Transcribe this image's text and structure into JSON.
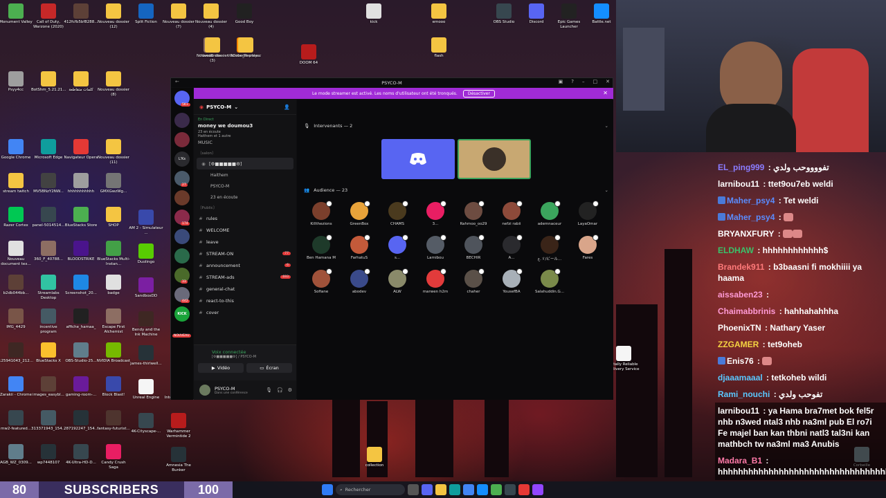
{
  "desktop_icons": [
    {
      "label": "Monument Valley",
      "color": "#4caf50"
    },
    {
      "label": "Call of Duty, Warzone (2020)",
      "color": "#c62828"
    },
    {
      "label": "412fcfb5bf8288...",
      "color": "#5d4037"
    },
    {
      "label": "Nouveau dossier (12)",
      "color": "#f4c542"
    },
    {
      "label": "Split Fiction",
      "color": "#1565c0"
    },
    {
      "label": "Nouveau dossier (7)",
      "color": "#f4c542"
    },
    {
      "label": "Nouveau dossier (4)",
      "color": "#f4c542"
    },
    {
      "label": "Good Boy",
      "color": "#212121"
    },
    {
      "label": "kick",
      "color": "#e0e0e0"
    },
    {
      "label": "emooo",
      "color": "#f4c542"
    },
    {
      "label": "OBS Studio",
      "color": "#37474f"
    },
    {
      "label": "Discord",
      "color": "#5865f2"
    },
    {
      "label": "Epic Games Launcher",
      "color": "#222"
    },
    {
      "label": "Battle.net",
      "color": "#148eff"
    },
    {
      "label": "HandBrake",
      "color": "#8d6e63"
    },
    {
      "label": "VLC media player",
      "color": "#ff8800"
    },
    {
      "label": "Psyy4cc",
      "color": "#9e9e9e"
    },
    {
      "label": "BotShm_5.21.21...",
      "color": "#f4c542"
    },
    {
      "label": "كلمات متقاطعة",
      "color": "#f4c542"
    },
    {
      "label": "Nouveau dossier (8)",
      "color": "#f4c542"
    },
    {
      "label": "Nouveau dossier (3)",
      "color": "#f4c542"
    },
    {
      "label": "Adobe_Premie...",
      "color": "#f4c542"
    },
    {
      "label": "DOOM 64",
      "color": "#b71c1c"
    },
    {
      "label": "flash",
      "color": "#f4c542"
    },
    {
      "label": "Google Chrome",
      "color": "#4285f4"
    },
    {
      "label": "Microsoft Edge",
      "color": "#0f9d9d"
    },
    {
      "label": "Navigateur Opera",
      "color": "#e53935"
    },
    {
      "label": "Nouveau dossier (11)",
      "color": "#f4c542"
    },
    {
      "label": "stream twitch",
      "color": "#f4c542"
    },
    {
      "label": "MV5BNzY2NW...",
      "color": "#424242"
    },
    {
      "label": "hhhhhhhhhhh",
      "color": "#9e9e9e"
    },
    {
      "label": "GMXGwzWg...",
      "color": "#757575"
    },
    {
      "label": "Razer Cortex",
      "color": "#00c853"
    },
    {
      "label": "panel-5014514...",
      "color": "#37474f"
    },
    {
      "label": "BlueStacks Store",
      "color": "#4caf50"
    },
    {
      "label": "SHOP",
      "color": "#f4c542"
    },
    {
      "label": "Nouveau document tex...",
      "color": "#e0e0e0"
    },
    {
      "label": "360_F_40788...",
      "color": "#8d6e63"
    },
    {
      "label": "BLOODSTRIKE",
      "color": "#4a148c"
    },
    {
      "label": "BlueStacks Multi-Instan...",
      "color": "#43a047"
    },
    {
      "label": "b2db044bb...",
      "color": "#5d4037"
    },
    {
      "label": "Streamlabs Desktop",
      "color": "#31c3a2"
    },
    {
      "label": "Screenshot_20...",
      "color": "#1e88e5"
    },
    {
      "label": "badge",
      "color": "#e0e0e0"
    },
    {
      "label": "IMG_4429",
      "color": "#795548"
    },
    {
      "label": "incentive program",
      "color": "#455a64"
    },
    {
      "label": "affiche_hamaa_",
      "color": "#212121"
    },
    {
      "label": "Escape First Alchemist",
      "color": "#8d6e63"
    },
    {
      "label": "125941043_212...",
      "color": "#3e2723"
    },
    {
      "label": "BlueStacks X",
      "color": "#fbc02d"
    },
    {
      "label": "OBS-Studio-25...",
      "color": "#607d8b"
    },
    {
      "label": "NVIDIA Broadcast",
      "color": "#76b900"
    },
    {
      "label": "Zarakii - Chrome",
      "color": "#4285f4"
    },
    {
      "label": "images_easybl...",
      "color": "#5d4037"
    },
    {
      "label": "gaming-room-...",
      "color": "#6a1b9a"
    },
    {
      "label": "Block Blast!",
      "color": "#3949ab"
    },
    {
      "label": "mw2-featured...",
      "color": "#37474f"
    },
    {
      "label": "313371943_154...",
      "color": "#455a64"
    },
    {
      "label": "287192247_154...",
      "color": "#263238"
    },
    {
      "label": "fantasy-futurist...",
      "color": "#4e342e"
    },
    {
      "label": "AGB_WZ_0309...",
      "color": "#607d8b"
    },
    {
      "label": "wp7448107",
      "color": "#263238"
    },
    {
      "label": "4K-Ultra-HD-D...",
      "color": "#37474f"
    },
    {
      "label": "Candy Crush Saga",
      "color": "#e91e63"
    },
    {
      "label": "call-duty-warz...",
      "color": "#4e342e"
    },
    {
      "label": "355331508_248...",
      "color": "#5d4037"
    },
    {
      "label": "313371307_154...",
      "color": "#37474f"
    },
    {
      "label": "photo-151512...",
      "color": "#6d4c41"
    },
    {
      "label": "Call of Duty, Warzone (...)",
      "color": "#ff9800"
    },
    {
      "label": "psyco_M",
      "color": "#2e7d32"
    },
    {
      "label": "9",
      "color": "#212121"
    },
    {
      "label": "Free Fire MAX",
      "color": "#ff6f00"
    }
  ],
  "desktop_icons_right": [
    {
      "label": "AM 2 - Simulateur ...",
      "color": "#3949ab"
    },
    {
      "label": "Duolingo",
      "color": "#58cc02"
    },
    {
      "label": "SandboxDD",
      "color": "#7b1fa2"
    },
    {
      "label": "Bendy and the Ink Machine",
      "color": "#3e2723"
    },
    {
      "label": "james-thirlwell...",
      "color": "#263238"
    },
    {
      "label": "Unreal Engine",
      "color": "#f5f5f5"
    },
    {
      "label": "4K-Cityscape-...",
      "color": "#37474f"
    },
    {
      "label": "Warhammer Vermintide 2",
      "color": "#b71c1c"
    },
    {
      "label": "Amnesia The Bunker",
      "color": "#263238"
    },
    {
      "label": "Intervention ...",
      "color": "#455a64"
    },
    {
      "label": "Totally Reliable Delivery Service",
      "color": "#f5f5f5"
    },
    {
      "label": "collection",
      "color": "#f4c542"
    },
    {
      "label": "Corbeille",
      "color": "#90a4ae"
    }
  ],
  "subscriber_bar": {
    "current": "80",
    "label": "SUBSCRIBERS",
    "goal": "100"
  },
  "taskbar": {
    "search_placeholder": "Rechercher",
    "search_icon": "search-icon"
  },
  "discord": {
    "title": "PSYCO-M",
    "banner_text": "Le mode streamer est activé. Les noms d'utilisateur ont été tronqués.",
    "banner_button": "Désactiver",
    "server_name": "PSYCO-M",
    "live_badge": "En Direct",
    "live_title": "money we doumou3",
    "live_listeners": "23 en écoute",
    "live_sub": "Haithem et 1 autre",
    "live_activity": "MUSIC",
    "server_badges": [
      "5K+",
      "27",
      "174",
      "33",
      "442",
      "NOUVEAU"
    ],
    "rail_label": "L'Ks",
    "kick_label": "KICK",
    "voice_channel": "[⚙︎■■■■■⚙︎]",
    "voice_channel_sub": "money we doumou3",
    "voice_users": [
      "Haithem",
      "PSYCO-M",
      "23 en écoute"
    ],
    "category_public": "〔Public〕",
    "category_salon": "〔salon〕",
    "channels": [
      {
        "name": "rules",
        "count": ""
      },
      {
        "name": "WELCOME",
        "count": ""
      },
      {
        "name": "leave",
        "count": ""
      },
      {
        "name": "STREAM-ON",
        "count": "77"
      },
      {
        "name": "announcement",
        "count": "6"
      },
      {
        "name": "STREAM-ads",
        "count": "693"
      },
      {
        "name": "general-chat",
        "count": ""
      },
      {
        "name": "react-to-this",
        "count": ""
      },
      {
        "name": "cover",
        "count": ""
      }
    ],
    "voice_connected": "Voix connectée",
    "voice_connected_sub": "[⚙︎■■■■■⚙︎] / PSYCO-M",
    "video_button": "Vidéo",
    "screen_button": "Écran",
    "user_name": "PSYCO-M",
    "user_status": "Dans une conférence",
    "speakers_header": "Intervenants — 2",
    "audience_header": "Audience — 23",
    "audience": [
      {
        "name": "Killthezions",
        "color": "#7b3f2c"
      },
      {
        "name": "GreenBox",
        "color": "#e8a33a"
      },
      {
        "name": "CHAMS",
        "color": "#4a3a1e"
      },
      {
        "name": "3...",
        "color": "#e91e63"
      },
      {
        "name": "Rahmoo_oo29",
        "color": "#6d4c41"
      },
      {
        "name": "nefzi rabii",
        "color": "#8d4a3a"
      },
      {
        "name": "ademnaceur",
        "color": "#3ba55d"
      },
      {
        "name": "LayaOmar",
        "color": "#222"
      },
      {
        "name": "Ben Hamana M",
        "color": "#1e3a2a"
      },
      {
        "name": "FarhatuS",
        "color": "#c45a3a"
      },
      {
        "name": "s...",
        "color": "#5865f2"
      },
      {
        "name": "Larnibou",
        "color": "#555c66"
      },
      {
        "name": "BECHIR",
        "color": "#4f545c"
      },
      {
        "name": "A...",
        "color": "#2a2a2e"
      },
      {
        "name": "ع.ゞ/ビール...",
        "color": "#3a2418"
      },
      {
        "name": "Fares",
        "color": "#d9a58a"
      },
      {
        "name": "Sofiane",
        "color": "#a0523a"
      },
      {
        "name": "abodev",
        "color": "#3a4a8a"
      },
      {
        "name": "ALW",
        "color": "#8a8a6a"
      },
      {
        "name": "marwen h2m",
        "color": "#e23b3b"
      },
      {
        "name": "chaher",
        "color": "#5a5048"
      },
      {
        "name": "YousefBA",
        "color": "#a8b0b8"
      },
      {
        "name": "Salahuddin.G...",
        "color": "#7a8a4a"
      }
    ]
  },
  "chat": [
    {
      "user": "EL_ping999",
      "color": "#8a7cff",
      "text": "تفووووحب ولدي",
      "dark": false
    },
    {
      "user": "larnibou11",
      "color": "#ffffff",
      "text": "ttet9ou7eb weldi",
      "dark": false
    },
    {
      "user": "Maher_psy4",
      "color": "#5a8cff",
      "text": "Tet weldi",
      "dark": false
    },
    {
      "user": "Maher_psy4",
      "color": "#5a8cff",
      "text": "",
      "dark": false
    },
    {
      "user": "BRYANXFURY",
      "color": "#ffffff",
      "text": "",
      "dark": false
    },
    {
      "user": "ELDHAW",
      "color": "#3ac26a",
      "text": "hhhhhhhhhhhh$",
      "dark": false
    },
    {
      "user": "Brandek911",
      "color": "#ff7a7a",
      "text": "b3baasni fi mokhiiii ya haama",
      "dark": false
    },
    {
      "user": "aissaben23",
      "color": "#ff9ad5",
      "text": "",
      "dark": false
    },
    {
      "user": "Chaimabbrinis",
      "color": "#ff9ad5",
      "text": "hahhahahhha",
      "dark": false
    },
    {
      "user": "PhoenixTN",
      "color": "#ffffff",
      "text": "Nathary Yaser",
      "dark": false
    },
    {
      "user": "ZZGAMER",
      "color": "#f5d442",
      "text": "tet9oheb",
      "dark": false
    },
    {
      "user": "Enis76",
      "color": "#ffffff",
      "text": "",
      "dark": false
    },
    {
      "user": "djaaamaaal",
      "color": "#5ac8ff",
      "text": "tetkoheb wildi",
      "dark": false
    },
    {
      "user": "Rami_nouchi",
      "color": "#5ac8ff",
      "text": "تفوحب ولدي",
      "dark": false
    },
    {
      "user": "larnibou11",
      "color": "#ffffff",
      "text": "ya Hama bra7met bok fel5r nhb n3wed ntal3 nhb na3ml pub El ro7i Fe majel ban kan thbni natl3 tal3ni kan mathbch tw na3ml ma3 Anubis",
      "dark": true
    },
    {
      "user": "Madara_B1",
      "color": "#ff7aa8",
      "text": "hhhhhhhhhhhhhhhhhhhhhhhhhhhhhhhhhhhhhh",
      "dark": true
    }
  ]
}
